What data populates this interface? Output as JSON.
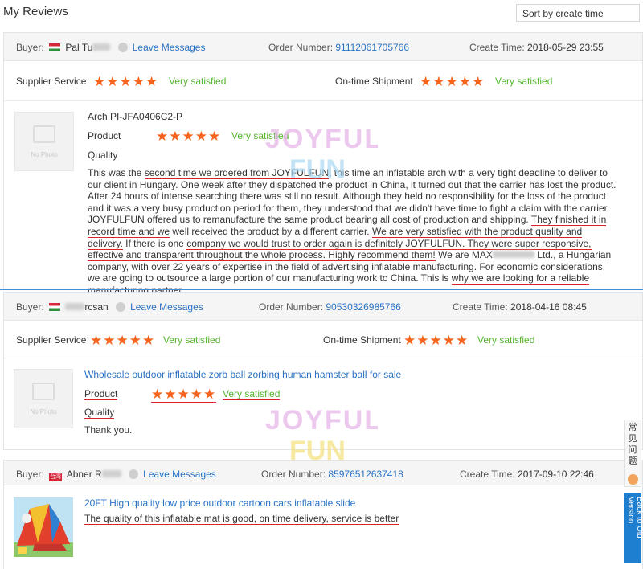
{
  "page": {
    "title": "My Reviews",
    "sort_label": "Sort by create time"
  },
  "side": {
    "qa_label": "常见问题",
    "back_label": "Back to Old Version"
  },
  "watermark": "JOYFULFUN",
  "reviews": [
    {
      "buyer_label": "Buyer:",
      "buyer_name": "Pal Tu",
      "messages_label": "Leave Messages",
      "order_label": "Order Number:",
      "order_number": "91112061705766",
      "time_label": "Create Time:",
      "create_time": "2018-05-29 23:55",
      "supplier_label": "Supplier Service",
      "supplier_rating": "★★★★★",
      "supplier_text": "Very satisfied",
      "shipment_label": "On-time Shipment",
      "shipment_rating": "★★★★★",
      "shipment_text": "Very satisfied",
      "product_title": "Arch PI-JFA0406C2-P",
      "product_label": "Product",
      "product_rating": "★★★★★",
      "product_text": "Very satisfied",
      "quality_label": "Quality",
      "no_photo": "No Photo",
      "comment": [
        "This was the ",
        "second time we ordered from JOYFULFUN",
        ", this time an inflatable arch with a very tight deadline to deliver to our client in Hungary. One week after they dispatched the product in China, it turned out that the carrier has lost the product. After 24 hours of intense searching there was still no result. Although they held no responsibility for the loss of the product and it was a very busy production period for them, they understood that we didn't have time to fight a claim with the carrier. JOYFULFUN offered us to remanufacture the same product bearing all cost of production and shipping. ",
        "They finished it in record time and we",
        " well received the product by a different carrier. ",
        "We are very satisfied with the product quality and delivery.",
        " If there is one ",
        "company we would trust to order again is definitely JOYFULFUN. They were super responsive, effective and transparent throughout the whole process. Highly recommend them!",
        " We are MAX",
        " Ltd., a Hungarian company, with over 22 years of expertise in the field of advertising inflatable manufacturing. For economic considerations, we are going to outsource a large portion of our manufacturing work to China. This is ",
        "why we are looking for a reliable manufacturing partner",
        "."
      ]
    },
    {
      "buyer_label": "Buyer:",
      "buyer_name": "rcsan",
      "messages_label": "Leave Messages",
      "order_label": "Order Number:",
      "order_number": "90530326985766",
      "time_label": "Create Time:",
      "create_time": "2018-04-16 08:45",
      "supplier_label": "Supplier Service",
      "supplier_rating": "★★★★★",
      "supplier_text": "Very satisfied",
      "shipment_label": "On-time Shipment",
      "shipment_rating": "★★★★★",
      "shipment_text": "Very satisfied",
      "product_title": "Wholesale outdoor inflatable zorb ball zorbing human hamster ball for sale",
      "product_label": "Product",
      "product_rating": "★★★★★",
      "product_text": "Very satisfied",
      "quality_label": "Quality",
      "comment": "Thank you.",
      "no_photo": "No Photo"
    },
    {
      "buyer_label": "Buyer:",
      "buyer_name": "Abner R",
      "flag_text": "台湾",
      "messages_label": "Leave Messages",
      "order_label": "Order Number:",
      "order_number": "85976512637418",
      "time_label": "Create Time:",
      "create_time": "2017-09-10 22:46",
      "product_title": "20FT High quality low price outdoor cartoon cars inflatable slide",
      "comment": "The quality of this inflatable mat is good, on time delivery, service is better"
    }
  ]
}
